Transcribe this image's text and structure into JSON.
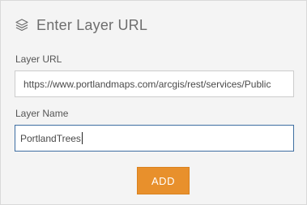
{
  "dialog": {
    "title": "Enter Layer URL",
    "icon": "layers-icon"
  },
  "layer_url": {
    "label": "Layer URL",
    "value": "https://www.portlandmaps.com/arcgis/rest/services/Public"
  },
  "layer_name": {
    "label": "Layer Name",
    "value": "PortlandTrees"
  },
  "add_button": {
    "label": "ADD",
    "color": "#e8902c"
  }
}
